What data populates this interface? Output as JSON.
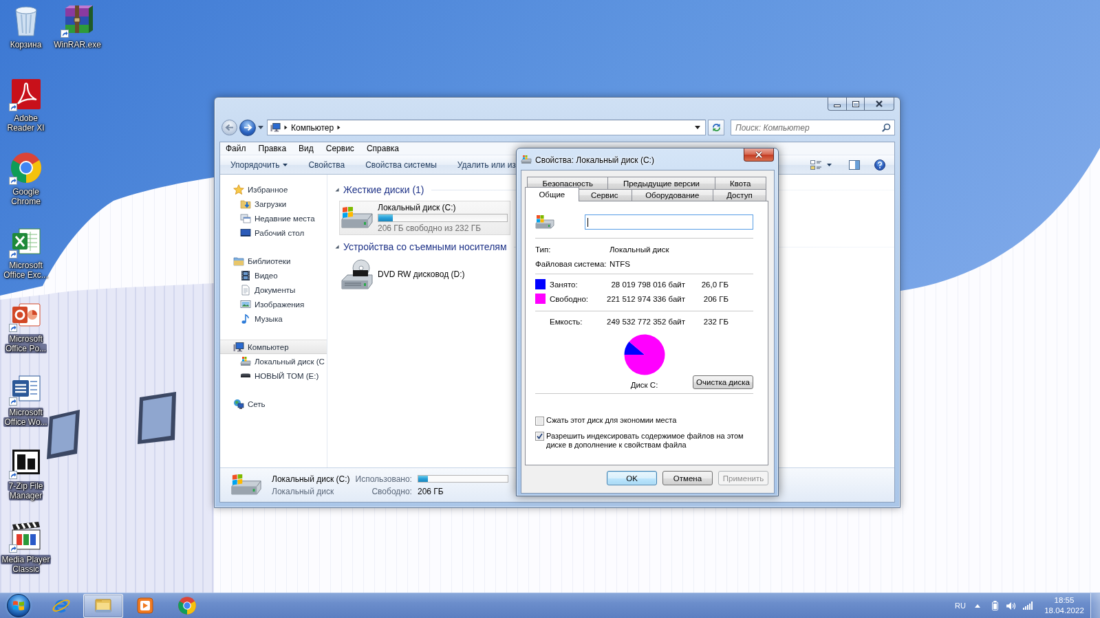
{
  "desktop": {
    "icons": [
      {
        "label": "Корзина",
        "kind": "recycle-bin",
        "shortcut": false
      },
      {
        "label": "Adobe Reader XI",
        "kind": "pdf-reader",
        "shortcut": true
      },
      {
        "label": "Google Chrome",
        "kind": "chrome",
        "shortcut": true
      },
      {
        "label": "Microsoft Office Exc...",
        "kind": "excel",
        "shortcut": true
      },
      {
        "label": "Microsoft Office Po...",
        "kind": "powerpoint",
        "shortcut": true
      },
      {
        "label": "Microsoft Office Wo...",
        "kind": "word",
        "shortcut": true
      },
      {
        "label": "7-Zip File Manager",
        "kind": "archiver-7z",
        "shortcut": true
      },
      {
        "label": "Media Player Classic",
        "kind": "media-player",
        "shortcut": true
      },
      {
        "label": "WinRAR.exe",
        "kind": "winrar",
        "shortcut": true
      }
    ]
  },
  "explorer": {
    "nav_buttons": [
      {
        "kind": "back",
        "disabled": true
      },
      {
        "kind": "forward",
        "disabled": false
      }
    ],
    "breadcrumb": [
      "Компьютер"
    ],
    "search": {
      "placeholder": "Поиск: Компьютер"
    },
    "menu": [
      "Файл",
      "Правка",
      "Вид",
      "Сервис",
      "Справка"
    ],
    "toolbar": [
      {
        "label": "Упорядочить",
        "dropdown": true
      },
      {
        "label": "Свойства",
        "dropdown": false
      },
      {
        "label": "Свойства системы",
        "dropdown": false
      },
      {
        "label": "Удалить или из",
        "dropdown": false
      }
    ],
    "navigation": [
      {
        "label": "Избранное",
        "kind": "favorites",
        "selected": false,
        "children": [
          {
            "label": "Загрузки",
            "kind": "downloads",
            "selected": false
          },
          {
            "label": "Недавние места",
            "kind": "recent",
            "selected": false
          },
          {
            "label": "Рабочий стол",
            "kind": "desktop",
            "selected": false
          }
        ]
      },
      {
        "label": "Библиотеки",
        "kind": "libraries",
        "selected": false,
        "children": [
          {
            "label": "Видео",
            "kind": "video",
            "selected": false
          },
          {
            "label": "Документы",
            "kind": "documents",
            "selected": false
          },
          {
            "label": "Изображения",
            "kind": "pictures",
            "selected": false
          },
          {
            "label": "Музыка",
            "kind": "music",
            "selected": false
          }
        ]
      },
      {
        "label": "Компьютер",
        "kind": "computer",
        "selected": true,
        "children": [
          {
            "label": "Локальный диск (C",
            "kind": "system-drive",
            "selected": false
          },
          {
            "label": "НОВЫЙ ТОМ (E:)",
            "kind": "drive",
            "selected": false
          }
        ]
      },
      {
        "label": "Сеть",
        "kind": "network",
        "selected": false
      }
    ],
    "groups": [
      {
        "title": "Жесткие диски (1)",
        "expanded": true,
        "items": [
          {
            "name": "Локальный диск (C:)",
            "kind": "system-drive",
            "selected": true,
            "level": 0.11,
            "info": "206 ГБ свободно из 232 ГБ"
          }
        ]
      },
      {
        "title": "Устройства со съемными носителям",
        "expanded": true,
        "items": [
          {
            "name": "DVD RW дисковод (D:)",
            "kind": "dvd",
            "selected": false
          }
        ]
      }
    ],
    "details": {
      "kind": "system-drive",
      "name": "Локальный диск (C:)",
      "type": "Локальный диск",
      "used_label": "Использовано:",
      "level": 0.11,
      "free_label": "Свободно:",
      "free_value": "206 ГБ"
    }
  },
  "dialog": {
    "title": "Свойства: Локальный диск (C:)",
    "tab_rows": [
      [
        {
          "label": "Безопасность",
          "selected": false
        },
        {
          "label": "Предыдущие версии",
          "selected": false
        },
        {
          "label": "Квота",
          "selected": false
        }
      ],
      [
        {
          "label": "Общие",
          "selected": true
        },
        {
          "label": "Сервис",
          "selected": false
        },
        {
          "label": "Оборудование",
          "selected": false
        },
        {
          "label": "Доступ",
          "selected": false
        }
      ]
    ],
    "name_field": {
      "focused": true
    },
    "properties": [
      {
        "label": "Тип:",
        "value": "Локальный диск"
      },
      {
        "label": "Файловая система:",
        "value": "NTFS"
      }
    ],
    "usage": [
      {
        "label": "Занято:",
        "bytes": "28 019 798 016 байт",
        "size": "26,0 ГБ",
        "color": "#0000ff"
      },
      {
        "label": "Свободно:",
        "bytes": "221 512 974 336 байт",
        "size": "206 ГБ",
        "color": "#ff00ff"
      }
    ],
    "capacity": {
      "label": "Емкость:",
      "bytes": "249 532 772 352 байт",
      "size": "232 ГБ"
    },
    "chart_data": {
      "type": "pie",
      "title": "Диск C:",
      "values": [
        11.2,
        88.8
      ]
    },
    "cleanup_button": "Очистка диска",
    "options": [
      {
        "label": "Сжать этот диск для экономии места",
        "checked": false
      },
      {
        "label": "Разрешить индексировать содержимое файлов на этом диске в дополнение к свойствам файла",
        "checked": true
      }
    ],
    "buttons": [
      {
        "label": "OK",
        "default": true,
        "disabled": false
      },
      {
        "label": "Отмена",
        "default": false,
        "disabled": false
      },
      {
        "label": "Применить",
        "default": false,
        "disabled": true
      }
    ]
  },
  "taskbar": {
    "apps": [
      {
        "kind": "ie",
        "selected": false
      },
      {
        "kind": "explorer",
        "selected": true
      },
      {
        "kind": "media-player",
        "selected": false
      },
      {
        "kind": "chrome",
        "selected": false
      }
    ],
    "language": "RU",
    "time": "18:55",
    "date": "18.04.2022"
  }
}
